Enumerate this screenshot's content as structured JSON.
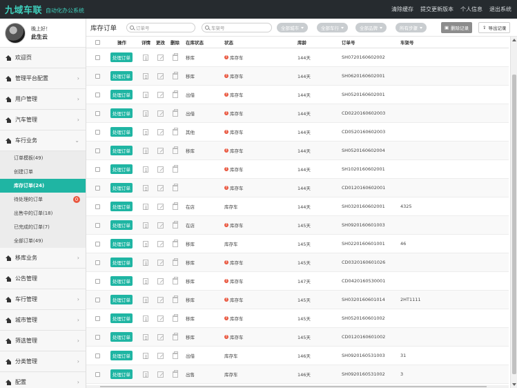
{
  "topbar": {
    "brand": "九域车联",
    "subtitle": "自动化办公系统",
    "links": [
      "清除缓存",
      "提交更新版本",
      "个人信息",
      "退出系统"
    ]
  },
  "user": {
    "greeting": "晚上好！",
    "name": "此生云"
  },
  "sidebar": {
    "items_top": [
      {
        "label": "欢迎页",
        "chevron": false
      },
      {
        "label": "管理平台配置",
        "chevron": true
      },
      {
        "label": "用户管理",
        "chevron": true
      },
      {
        "label": "汽车管理",
        "chevron": true
      },
      {
        "label": "车行业务",
        "chevron": true,
        "expanded": true
      }
    ],
    "sub_items": [
      {
        "label": "订单模板(49)",
        "active": false
      },
      {
        "label": "创建订单",
        "active": false
      },
      {
        "label": "库存订单(24)",
        "active": true
      },
      {
        "label": "待处理的订单",
        "active": false,
        "badge": "0"
      },
      {
        "label": "出售中的订单(18)",
        "active": false
      },
      {
        "label": "已完成的订单(7)",
        "active": false
      },
      {
        "label": "全部订单(49)",
        "active": false
      }
    ],
    "items_bottom": [
      {
        "label": "移库业务",
        "chevron": true
      },
      {
        "label": "公告管理",
        "chevron": false
      },
      {
        "label": "车行管理",
        "chevron": true
      },
      {
        "label": "城市管理",
        "chevron": true
      },
      {
        "label": "筛选管理",
        "chevron": true
      },
      {
        "label": "分类管理",
        "chevron": true
      },
      {
        "label": "配置",
        "chevron": true
      }
    ]
  },
  "toolbar": {
    "title": "库存订单",
    "search_order_placeholder": "订单号",
    "search_vin_placeholder": "车架号",
    "filters": [
      "全部城市",
      "全部车行",
      "全部品牌",
      "所有步骤"
    ],
    "delete_label": "删除记录",
    "export_label": "导出记录"
  },
  "table": {
    "headers": [
      "操作",
      "详情",
      "更改",
      "删除",
      "在库状态",
      "状态",
      "库龄",
      "订单号",
      "车架号"
    ],
    "op_label": "处理订单",
    "rows": [
      {
        "loc": "移库",
        "status": "库存车",
        "warn": true,
        "age": "144天",
        "order": "SH0720160602002",
        "vin": ""
      },
      {
        "loc": "移库",
        "status": "库存车",
        "warn": true,
        "age": "144天",
        "order": "SH0620160602001",
        "vin": ""
      },
      {
        "loc": "出借",
        "status": "库存车",
        "warn": true,
        "age": "144天",
        "order": "SH0520160602001",
        "vin": ""
      },
      {
        "loc": "出借",
        "status": "库存车",
        "warn": true,
        "age": "144天",
        "order": "CD0220160602003",
        "vin": ""
      },
      {
        "loc": "其他",
        "status": "库存车",
        "warn": true,
        "age": "144天",
        "order": "CD0520160602003",
        "vin": ""
      },
      {
        "loc": "移库",
        "status": "库存车",
        "warn": true,
        "age": "144天",
        "order": "SH0520160602004",
        "vin": ""
      },
      {
        "loc": "",
        "status": "库存车",
        "warn": true,
        "age": "144天",
        "order": "SH1020160602001",
        "vin": ""
      },
      {
        "loc": "",
        "status": "库存车",
        "warn": true,
        "age": "144天",
        "order": "CD0120160602001",
        "vin": ""
      },
      {
        "loc": "在店",
        "status": "库存车",
        "warn": false,
        "age": "144天",
        "order": "SH0320160602001",
        "vin": "4325"
      },
      {
        "loc": "在店",
        "status": "库存车",
        "warn": true,
        "age": "145天",
        "order": "SH0920160601003",
        "vin": ""
      },
      {
        "loc": "移库",
        "status": "库存车",
        "warn": false,
        "age": "145天",
        "order": "SH0220160601001",
        "vin": "46"
      },
      {
        "loc": "移库",
        "status": "库存车",
        "warn": true,
        "age": "145天",
        "order": "CD0320160601026",
        "vin": ""
      },
      {
        "loc": "移库",
        "status": "库存车",
        "warn": true,
        "age": "147天",
        "order": "CD0420160530001",
        "vin": ""
      },
      {
        "loc": "移库",
        "status": "库存车",
        "warn": true,
        "age": "145天",
        "order": "SH0320160601014",
        "vin": "2HT1111"
      },
      {
        "loc": "移库",
        "status": "库存车",
        "warn": true,
        "age": "145天",
        "order": "SH0520160601002",
        "vin": ""
      },
      {
        "loc": "移库",
        "status": "库存车",
        "warn": true,
        "age": "145天",
        "order": "CD0120160601002",
        "vin": ""
      },
      {
        "loc": "出借",
        "status": "库存车",
        "warn": false,
        "age": "146天",
        "order": "SH0920160531003",
        "vin": "31"
      },
      {
        "loc": "出售",
        "status": "库存车",
        "warn": false,
        "age": "146天",
        "order": "SH0920160531002",
        "vin": "3"
      }
    ]
  },
  "colors": {
    "accent": "#1fb5a3",
    "topbar": "#262b2f",
    "brand": "#3fd0bd",
    "warn": "#e9573f"
  }
}
